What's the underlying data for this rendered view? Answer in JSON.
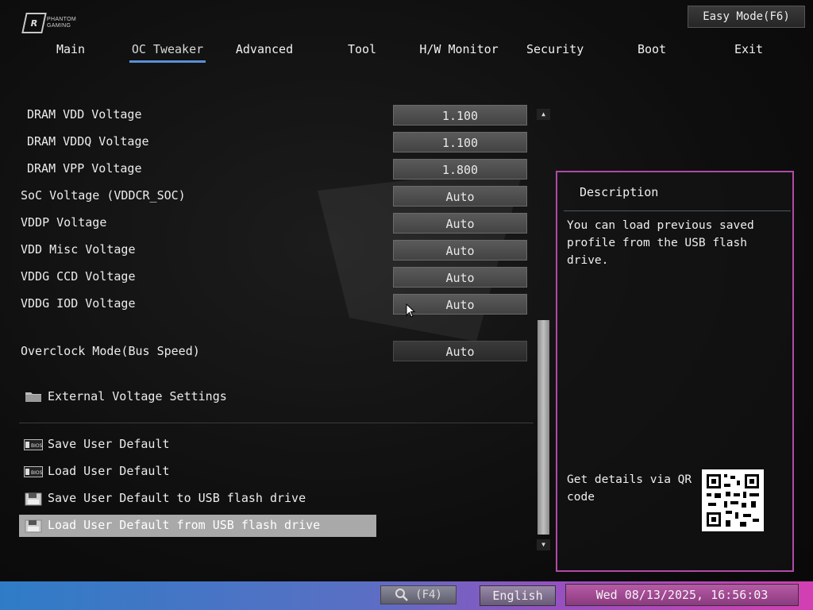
{
  "logo": {
    "mark": "R",
    "text_line1": "PHANTOM",
    "text_line2": "GAMING"
  },
  "header": {
    "easy_mode": "Easy Mode(F6)"
  },
  "tabs": [
    {
      "label": "Main"
    },
    {
      "label": "OC Tweaker"
    },
    {
      "label": "Advanced"
    },
    {
      "label": "Tool"
    },
    {
      "label": "H/W Monitor"
    },
    {
      "label": "Security"
    },
    {
      "label": "Boot"
    },
    {
      "label": "Exit"
    }
  ],
  "active_tab": "OC Tweaker",
  "settings": [
    {
      "label": "DRAM VDD Voltage",
      "value": "1.100"
    },
    {
      "label": "DRAM VDDQ Voltage",
      "value": "1.100"
    },
    {
      "label": "DRAM VPP Voltage",
      "value": "1.800"
    },
    {
      "label": "SoC Voltage (VDDCR_SOC)",
      "value": "Auto"
    },
    {
      "label": "VDDP Voltage",
      "value": "Auto"
    },
    {
      "label": "VDD Misc Voltage",
      "value": "Auto"
    },
    {
      "label": "VDDG CCD Voltage",
      "value": "Auto"
    },
    {
      "label": "VDDG IOD Voltage",
      "value": "Auto"
    },
    {
      "label": "Overclock Mode(Bus Speed)",
      "value": "Auto"
    }
  ],
  "submenu": {
    "label": "External Voltage Settings",
    "icon": "folder-icon"
  },
  "actions": [
    {
      "label": "Save User Default",
      "icon": "bios-chip-icon"
    },
    {
      "label": "Load User Default",
      "icon": "bios-chip-icon"
    },
    {
      "label": "Save User Default to USB flash drive",
      "icon": "usb-drive-icon"
    },
    {
      "label": "Load User Default from USB flash drive",
      "icon": "usb-drive-icon",
      "selected": true
    }
  ],
  "description": {
    "title": "Description",
    "text": "You can load previous saved\nprofile from the USB flash drive.",
    "qr_label": "Get details via QR\ncode"
  },
  "footer": {
    "search_key": "(F4)",
    "language": "English",
    "datetime": "Wed 08/13/2025, 16:56:03"
  },
  "colors": {
    "tab_underline": "#5a8fd6",
    "desc_border": "#b04aa8",
    "selected_row": "#a9a9a9"
  }
}
